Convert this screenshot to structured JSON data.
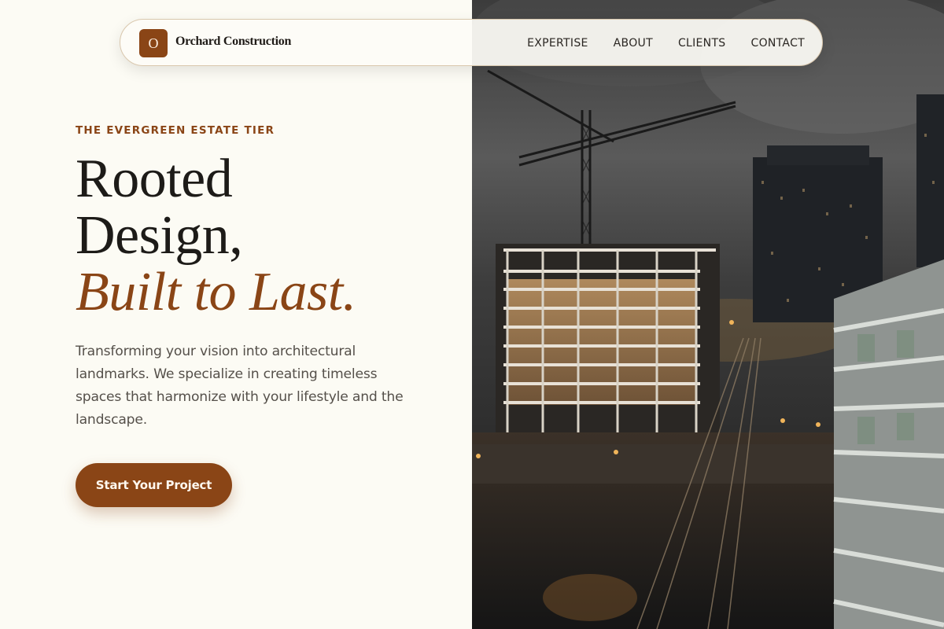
{
  "nav": {
    "logo_letter": "O",
    "brand_name": "Orchard Construction",
    "links": [
      "EXPERTISE",
      "ABOUT",
      "CLIENTS",
      "CONTACT"
    ]
  },
  "hero": {
    "eyebrow": "THE EVERGREEN ESTATE TIER",
    "headline_line1": "Rooted",
    "headline_line2": "Design,",
    "headline_accent": "Built to Last.",
    "description": "Transforming your vision into architectural landmarks. We specialize in creating timeless spaces that harmonize with your lifestyle and the landscape.",
    "cta_label": "Start Your Project"
  },
  "colors": {
    "background": "#fcfbf4",
    "accent": "#8a4516",
    "text": "#1d1b18"
  }
}
